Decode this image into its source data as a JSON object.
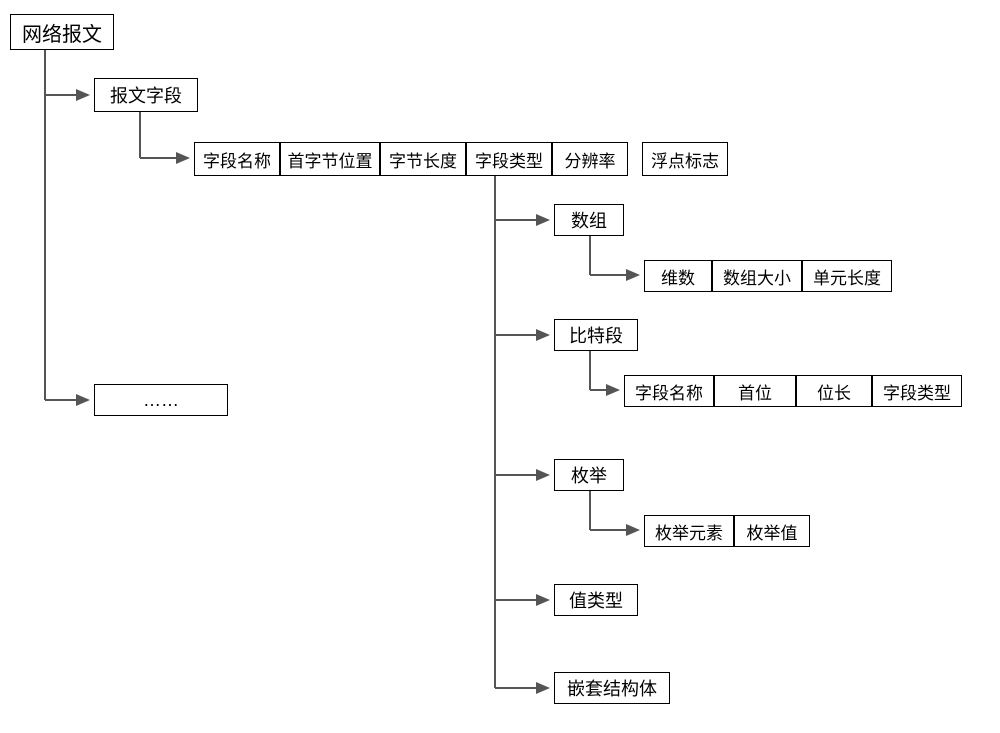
{
  "root": {
    "label": "网络报文"
  },
  "message_field": {
    "label": "报文字段"
  },
  "ellipsis": {
    "label": "……"
  },
  "field_attrs": {
    "name": "字段名称",
    "first_byte": "首字节位置",
    "byte_len": "字节长度",
    "field_type": "字段类型",
    "resolution": "分辨率",
    "float_flag": "浮点标志"
  },
  "types": {
    "array": {
      "label": "数组",
      "dims": "维数",
      "size": "数组大小",
      "unit_len": "单元长度"
    },
    "bitfield": {
      "label": "比特段",
      "name": "字段名称",
      "first_bit": "首位",
      "bit_len": "位长",
      "field_type": "字段类型"
    },
    "enum": {
      "label": "枚举",
      "element": "枚举元素",
      "value": "枚举值"
    },
    "value_type": {
      "label": "值类型"
    },
    "nested_struct": {
      "label": "嵌套结构体"
    }
  }
}
